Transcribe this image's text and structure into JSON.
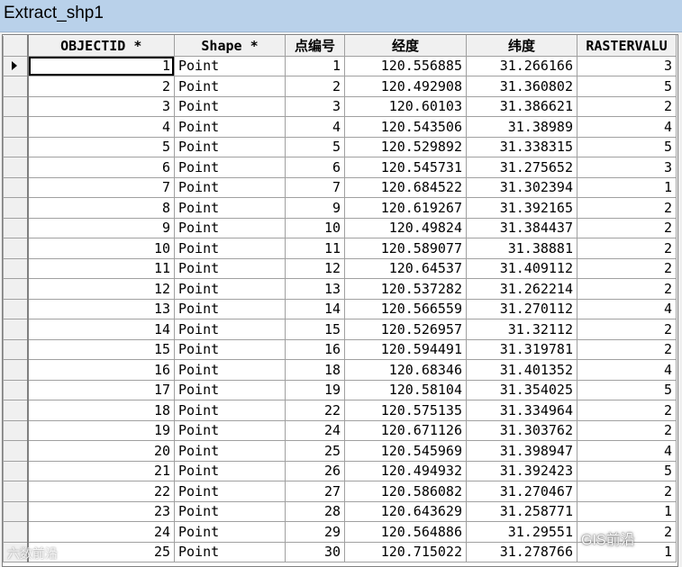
{
  "window": {
    "title": "Extract_shp1"
  },
  "table": {
    "columns": [
      "OBJECTID *",
      "Shape *",
      "点编号",
      "经度",
      "纬度",
      "RASTERVALU"
    ],
    "rows": [
      [
        "1",
        "Point",
        "1",
        "120.556885",
        "31.266166",
        "3"
      ],
      [
        "2",
        "Point",
        "2",
        "120.492908",
        "31.360802",
        "5"
      ],
      [
        "3",
        "Point",
        "3",
        "120.60103",
        "31.386621",
        "2"
      ],
      [
        "4",
        "Point",
        "4",
        "120.543506",
        "31.38989",
        "4"
      ],
      [
        "5",
        "Point",
        "5",
        "120.529892",
        "31.338315",
        "5"
      ],
      [
        "6",
        "Point",
        "6",
        "120.545731",
        "31.275652",
        "3"
      ],
      [
        "7",
        "Point",
        "7",
        "120.684522",
        "31.302394",
        "1"
      ],
      [
        "8",
        "Point",
        "9",
        "120.619267",
        "31.392165",
        "2"
      ],
      [
        "9",
        "Point",
        "10",
        "120.49824",
        "31.384437",
        "2"
      ],
      [
        "10",
        "Point",
        "11",
        "120.589077",
        "31.38881",
        "2"
      ],
      [
        "11",
        "Point",
        "12",
        "120.64537",
        "31.409112",
        "2"
      ],
      [
        "12",
        "Point",
        "13",
        "120.537282",
        "31.262214",
        "2"
      ],
      [
        "13",
        "Point",
        "14",
        "120.566559",
        "31.270112",
        "4"
      ],
      [
        "14",
        "Point",
        "15",
        "120.526957",
        "31.32112",
        "2"
      ],
      [
        "15",
        "Point",
        "16",
        "120.594491",
        "31.319781",
        "2"
      ],
      [
        "16",
        "Point",
        "18",
        "120.68346",
        "31.401352",
        "4"
      ],
      [
        "17",
        "Point",
        "19",
        "120.58104",
        "31.354025",
        "5"
      ],
      [
        "18",
        "Point",
        "22",
        "120.575135",
        "31.334964",
        "2"
      ],
      [
        "19",
        "Point",
        "24",
        "120.671126",
        "31.303762",
        "2"
      ],
      [
        "20",
        "Point",
        "25",
        "120.545969",
        "31.398947",
        "4"
      ],
      [
        "21",
        "Point",
        "26",
        "120.494932",
        "31.392423",
        "5"
      ],
      [
        "22",
        "Point",
        "27",
        "120.586082",
        "31.270467",
        "2"
      ],
      [
        "23",
        "Point",
        "28",
        "120.643629",
        "31.258771",
        "1"
      ],
      [
        "24",
        "Point",
        "29",
        "120.564886",
        "31.29551",
        "2"
      ],
      [
        "25",
        "Point",
        "30",
        "120.715022",
        "31.278766",
        "1"
      ]
    ]
  },
  "watermark": {
    "left": "六数前沿",
    "right": "GIS前沿"
  }
}
